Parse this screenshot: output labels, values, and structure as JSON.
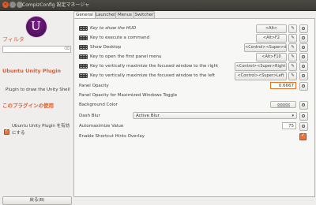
{
  "window": {
    "title": "CompizConfig 設定マネージャ"
  },
  "sidebar": {
    "filter_label": "フィルタ",
    "search_value": "",
    "plugin_name": "Ubuntu Unity Plugin",
    "plugin_description": "Plugin to draw the Unity Shell",
    "use_label": "このプラグインの使用",
    "enable_label": "Ubuntu Unity Plugin を有効にする",
    "enable_checked": true,
    "back_button": "戻る(B)"
  },
  "tabs": [
    "General",
    "Launcher",
    "Menus",
    "Switcher"
  ],
  "active_tab": "General",
  "settings": [
    {
      "label": "Key to show the HUD",
      "value": "<Alt>",
      "italic": true
    },
    {
      "label": "Key to execute a command",
      "value": "<Alt>F2"
    },
    {
      "label": "Show Desktop",
      "value": "<Control><Super>d"
    },
    {
      "label": "Key to open the first panel menu",
      "value": "<Alt>F10"
    },
    {
      "label": "Key to vertically maximize the focused window to the right",
      "value": "<Control><Super>Right"
    },
    {
      "label": "Key to vertically maximize the focused window to the left",
      "value": "<Control><Super>Left"
    },
    {
      "label": "Panel Opacity",
      "value": "0.6667"
    },
    {
      "label": "Panel Opacity for Maximized Windows Toggle",
      "value": ""
    },
    {
      "label": "Background Color",
      "value": ""
    },
    {
      "label": "Dash Blur",
      "value": "Active Blur"
    },
    {
      "label": "Automaximize Value",
      "value": "75"
    },
    {
      "label": "Enable Shortcut Hints Overlay",
      "value": ""
    }
  ],
  "icons": {
    "close": "×",
    "edit": "✎",
    "reset": "reset-icon",
    "dropdown": "▾",
    "spin_up": "▴",
    "spin_down": "▾"
  },
  "colors": {
    "accent": "#e05a2b",
    "titlebar": "#3c3b37"
  }
}
